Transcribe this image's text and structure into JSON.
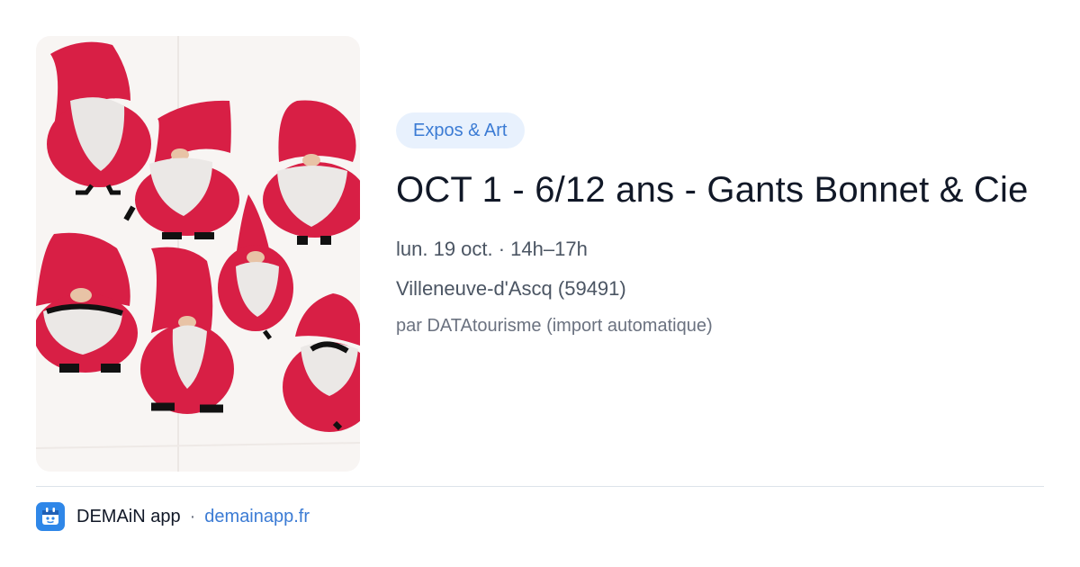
{
  "event": {
    "category": "Expos & Art",
    "title": "OCT 1 - 6/12 ans - Gants Bonnet & Cie",
    "date": "lun. 19 oct. · 14h–17h",
    "location": "Villeneuve-d'Ascq (59491)",
    "source": "par DATAtourisme (import automatique)",
    "image_icon": "gnome-drawings-photo"
  },
  "footer": {
    "app_name": "DEMAiN app",
    "separator": "·",
    "domain": "demainapp.fr",
    "logo_icon": "demain-logo-icon"
  },
  "colors": {
    "accent": "#3b7bd4",
    "tag_bg": "#e8f1fd",
    "gnome_red": "#d81f45",
    "logo_bg": "#2f87e8"
  }
}
